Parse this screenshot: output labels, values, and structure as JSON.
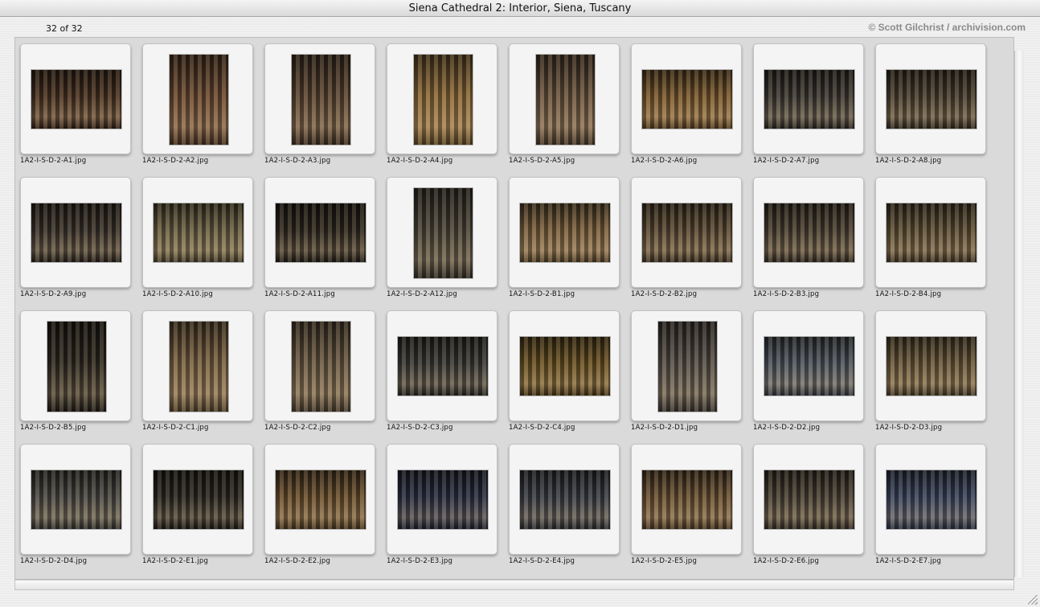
{
  "window": {
    "title": "Siena Cathedral 2: Interior, Siena, Tuscany",
    "count_text": "32 of 32",
    "copyright": "© Scott Gilchrist / archivision.com"
  },
  "colors": {
    "window_bg": "#ececec",
    "slide_bg": "#f4f4f4",
    "copyright": "#8a8a8a"
  },
  "thumbnails": [
    {
      "filename": "1A2-I-S-D-2-A1.jpg",
      "orientation": "landscape",
      "tone": "#4a3323"
    },
    {
      "filename": "1A2-I-S-D-2-A2.jpg",
      "orientation": "portrait",
      "tone": "#6b4a33"
    },
    {
      "filename": "1A2-I-S-D-2-A3.jpg",
      "orientation": "portrait",
      "tone": "#5a4533"
    },
    {
      "filename": "1A2-I-S-D-2-A4.jpg",
      "orientation": "portrait",
      "tone": "#8a6a3a"
    },
    {
      "filename": "1A2-I-S-D-2-A5.jpg",
      "orientation": "portrait",
      "tone": "#6a5440"
    },
    {
      "filename": "1A2-I-S-D-2-A6.jpg",
      "orientation": "landscape",
      "tone": "#7a5a30"
    },
    {
      "filename": "1A2-I-S-D-2-A7.jpg",
      "orientation": "landscape",
      "tone": "#3e3a36"
    },
    {
      "filename": "1A2-I-S-D-2-A8.jpg",
      "orientation": "landscape",
      "tone": "#4a4032"
    },
    {
      "filename": "1A2-I-S-D-2-A9.jpg",
      "orientation": "landscape",
      "tone": "#3a332c"
    },
    {
      "filename": "1A2-I-S-D-2-A10.jpg",
      "orientation": "landscape",
      "tone": "#6a6045"
    },
    {
      "filename": "1A2-I-S-D-2-A11.jpg",
      "orientation": "landscape",
      "tone": "#2e2820"
    },
    {
      "filename": "1A2-I-S-D-2-A12.jpg",
      "orientation": "portrait",
      "tone": "#4a453a"
    },
    {
      "filename": "1A2-I-S-D-2-B1.jpg",
      "orientation": "landscape",
      "tone": "#7a6040"
    },
    {
      "filename": "1A2-I-S-D-2-B2.jpg",
      "orientation": "landscape",
      "tone": "#5a4a35"
    },
    {
      "filename": "1A2-I-S-D-2-B3.jpg",
      "orientation": "landscape",
      "tone": "#4a4034"
    },
    {
      "filename": "1A2-I-S-D-2-B4.jpg",
      "orientation": "landscape",
      "tone": "#5e5038"
    },
    {
      "filename": "1A2-I-S-D-2-B5.jpg",
      "orientation": "portrait",
      "tone": "#2e2a22"
    },
    {
      "filename": "1A2-I-S-D-2-C1.jpg",
      "orientation": "portrait",
      "tone": "#7a6245"
    },
    {
      "filename": "1A2-I-S-D-2-C2.jpg",
      "orientation": "portrait",
      "tone": "#6a5a45"
    },
    {
      "filename": "1A2-I-S-D-2-C3.jpg",
      "orientation": "landscape",
      "tone": "#3a3a38"
    },
    {
      "filename": "1A2-I-S-D-2-C4.jpg",
      "orientation": "landscape",
      "tone": "#6a5225"
    },
    {
      "filename": "1A2-I-S-D-2-D1.jpg",
      "orientation": "portrait",
      "tone": "#55504a"
    },
    {
      "filename": "1A2-I-S-D-2-D2.jpg",
      "orientation": "landscape",
      "tone": "#4e5560"
    },
    {
      "filename": "1A2-I-S-D-2-D3.jpg",
      "orientation": "landscape",
      "tone": "#6a5a3e"
    },
    {
      "filename": "1A2-I-S-D-2-D4.jpg",
      "orientation": "landscape",
      "tone": "#4a4a46"
    },
    {
      "filename": "1A2-I-S-D-2-E1.jpg",
      "orientation": "landscape",
      "tone": "#2a2824"
    },
    {
      "filename": "1A2-I-S-D-2-E2.jpg",
      "orientation": "landscape",
      "tone": "#6a5030"
    },
    {
      "filename": "1A2-I-S-D-2-E3.jpg",
      "orientation": "landscape",
      "tone": "#2a3045"
    },
    {
      "filename": "1A2-I-S-D-2-E4.jpg",
      "orientation": "landscape",
      "tone": "#3a3e48"
    },
    {
      "filename": "1A2-I-S-D-2-E5.jpg",
      "orientation": "landscape",
      "tone": "#6a5235"
    },
    {
      "filename": "1A2-I-S-D-2-E6.jpg",
      "orientation": "landscape",
      "tone": "#4a4238"
    },
    {
      "filename": "1A2-I-S-D-2-E7.jpg",
      "orientation": "landscape",
      "tone": "#3a4660"
    }
  ]
}
